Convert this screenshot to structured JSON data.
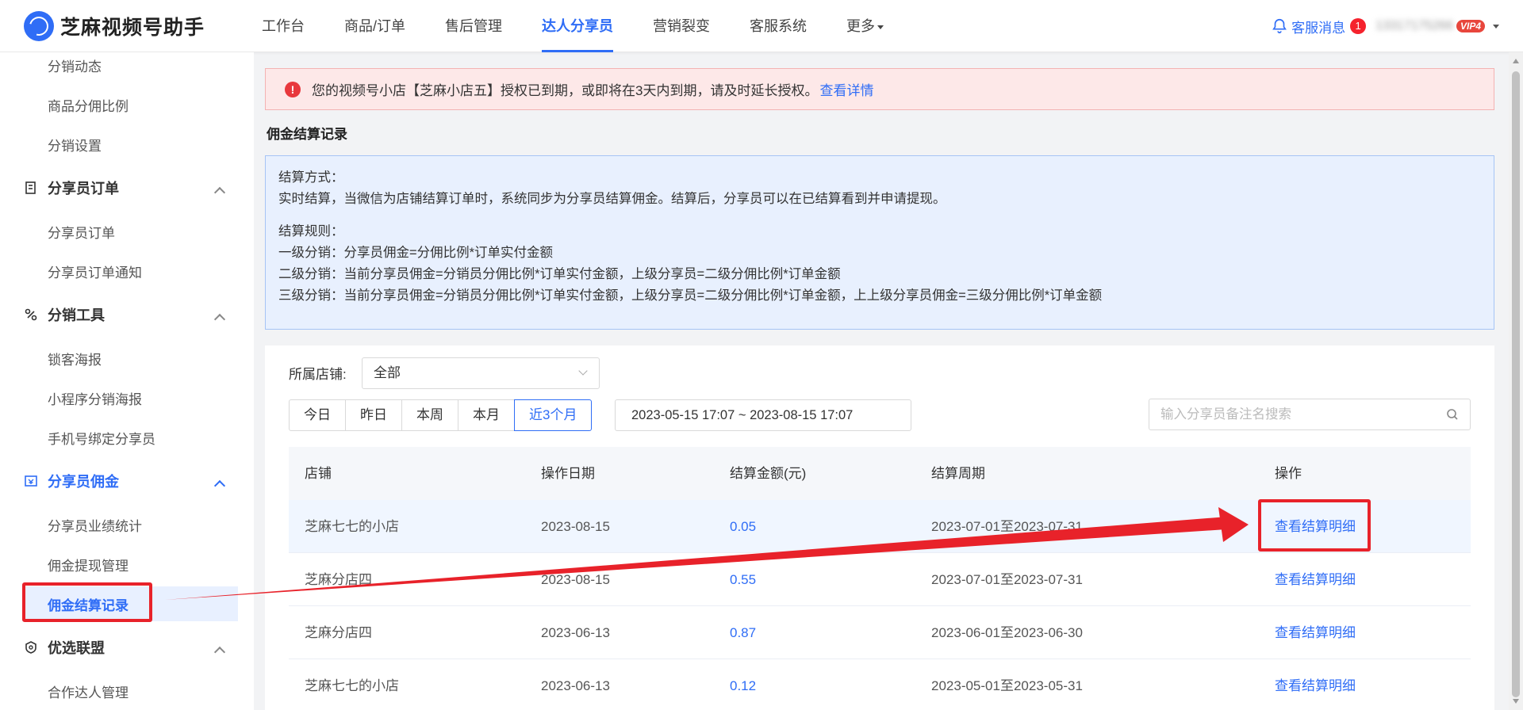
{
  "header": {
    "app_name": "芝麻视频号助手",
    "nav": [
      "工作台",
      "商品/订单",
      "售后管理",
      "达人分享员",
      "营销裂变",
      "客服系统",
      "更多"
    ],
    "messages_label": "客服消息",
    "messages_count": "1",
    "account": "13317175266",
    "vip": "VIP4"
  },
  "sidebar": {
    "items_top": [
      "分销动态",
      "商品分佣比例",
      "分销设置"
    ],
    "group_orders": "分享员订单",
    "orders_items": [
      "分享员订单",
      "分享员订单通知"
    ],
    "group_tools": "分销工具",
    "tools_items": [
      "锁客海报",
      "小程序分销海报",
      "手机号绑定分享员"
    ],
    "group_commission": "分享员佣金",
    "commission_items": [
      "分享员业绩统计",
      "佣金提现管理",
      "佣金结算记录"
    ],
    "group_alliance": "优选联盟",
    "alliance_items": [
      "合作达人管理"
    ]
  },
  "alert": {
    "text": "您的视频号小店【芝麻小店五】授权已到期，或即将在3天内到期，请及时延长授权。",
    "link": "查看详情"
  },
  "page_title": "佣金结算记录",
  "info": {
    "method_title": "结算方式：",
    "method_text": "实时结算，当微信为店铺结算订单时，系统同步为分享员结算佣金。结算后，分享员可以在已结算看到并申请提现。",
    "rules_title": "结算规则：",
    "rule1": "一级分销：分享员佣金=分佣比例*订单实付金额",
    "rule2": "二级分销：当前分享员佣金=分销员分佣比例*订单实付金额，上级分享员=二级分佣比例*订单金额",
    "rule3": "三级分销：当前分享员佣金=分销员分佣比例*订单实付金额，上级分享员=二级分佣比例*订单金额，上上级分享员佣金=三级分佣比例*订单金额"
  },
  "filters": {
    "store_label": "所属店铺:",
    "store_value": "全部",
    "periods": [
      "今日",
      "昨日",
      "本周",
      "本月",
      "近3个月"
    ],
    "date_range": "2023-05-15 17:07  ~  2023-08-15 17:07",
    "search_placeholder": "输入分享员备注名搜索"
  },
  "table": {
    "headers": [
      "店铺",
      "操作日期",
      "结算金额(元)",
      "结算周期",
      "操作"
    ],
    "rows": [
      {
        "store": "芝麻七七的小店",
        "date": "2023-08-15",
        "amount": "0.05",
        "period": "2023-07-01至2023-07-31",
        "action": "查看结算明细"
      },
      {
        "store": "芝麻分店四",
        "date": "2023-08-15",
        "amount": "0.55",
        "period": "2023-07-01至2023-07-31",
        "action": "查看结算明细"
      },
      {
        "store": "芝麻分店四",
        "date": "2023-06-13",
        "amount": "0.87",
        "period": "2023-06-01至2023-06-30",
        "action": "查看结算明细"
      },
      {
        "store": "芝麻七七的小店",
        "date": "2023-06-13",
        "amount": "0.12",
        "period": "2023-05-01至2023-05-31",
        "action": "查看结算明细"
      }
    ]
  },
  "colors": {
    "accent": "#2f6df6",
    "annotation": "#e8222a",
    "alert_bg": "#fde8e8",
    "info_bg": "#e8f0fe"
  }
}
